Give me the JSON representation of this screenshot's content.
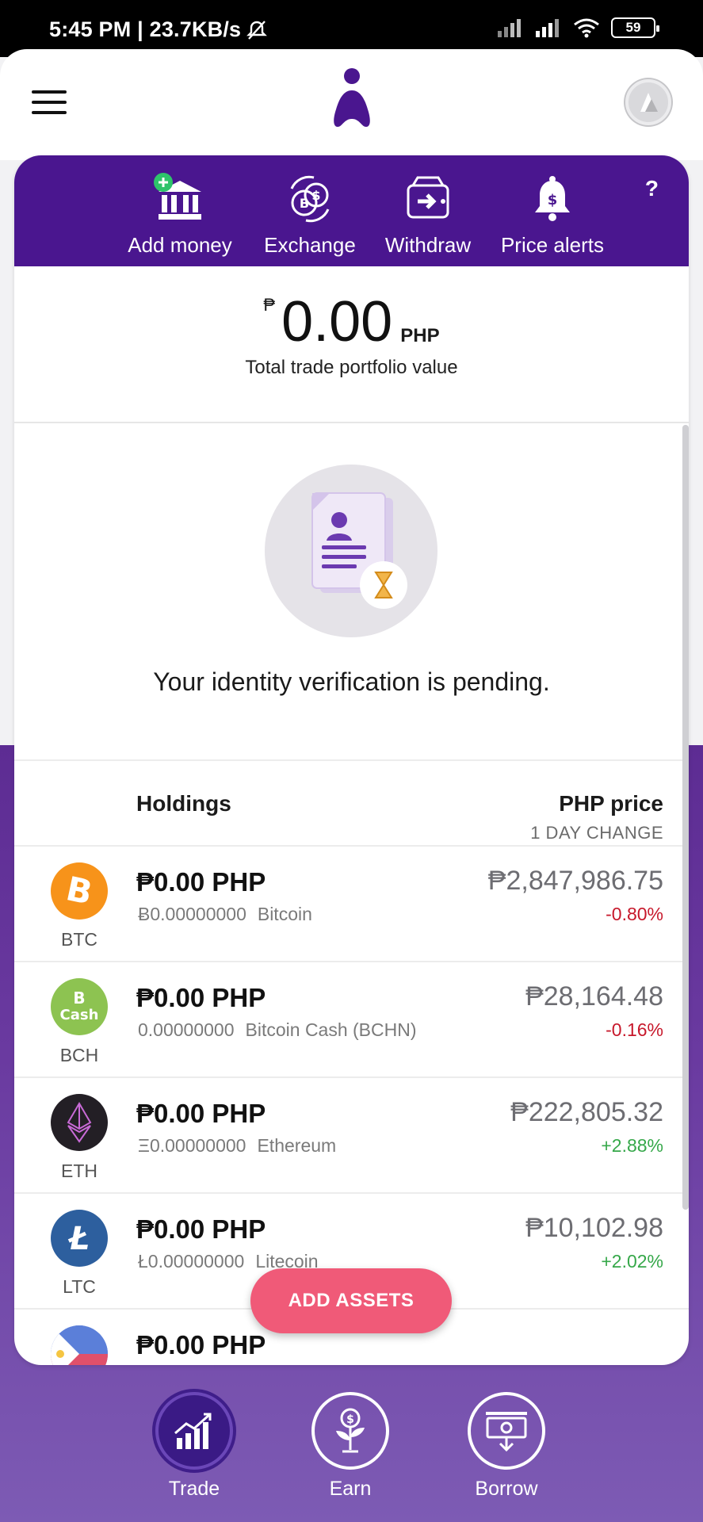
{
  "status_bar": {
    "time": "5:45 PM | 23.7KB/s",
    "battery": "59"
  },
  "header": {
    "menu_icon": "hamburger-menu-icon",
    "logo_icon": "app-logo",
    "profile_icon": "profile-avatar"
  },
  "actions": [
    {
      "label": "Add money",
      "icon": "bank-plus-icon"
    },
    {
      "label": "Exchange",
      "icon": "coins-exchange-icon"
    },
    {
      "label": "Withdraw",
      "icon": "wallet-arrow-icon"
    },
    {
      "label": "Price alerts",
      "icon": "bell-dollar-icon"
    }
  ],
  "help_label": "?",
  "portfolio": {
    "currency_symbol": "₱",
    "value": "0.00",
    "unit": "PHP",
    "label": "Total trade portfolio value"
  },
  "verification": {
    "message": "Your identity verification is pending."
  },
  "holdings_header": {
    "left": "Holdings",
    "right": "PHP price",
    "right_sub": "1 DAY CHANGE"
  },
  "holdings": [
    {
      "ticker": "BTC",
      "amount": "₱0.00 PHP",
      "quantity": "Ƀ0.00000000",
      "name": "Bitcoin",
      "price": "₱2,847,986.75",
      "change": "-0.80%"
    },
    {
      "ticker": "BCH",
      "amount": "₱0.00 PHP",
      "quantity": "0.00000000",
      "name": "Bitcoin Cash (BCHN)",
      "price": "₱28,164.48",
      "change": "-0.16%"
    },
    {
      "ticker": "ETH",
      "amount": "₱0.00 PHP",
      "quantity": "Ξ0.00000000",
      "name": "Ethereum",
      "price": "₱222,805.32",
      "change": "+2.88%"
    },
    {
      "ticker": "LTC",
      "amount": "₱0.00 PHP",
      "quantity": "Ł0.00000000",
      "name": "Litecoin",
      "price": "₱10,102.98",
      "change": "+2.02%"
    },
    {
      "amount": "₱0.00 PHP"
    }
  ],
  "add_assets_label": "ADD ASSETS",
  "bottom_nav": [
    {
      "label": "Trade",
      "icon": "chart-up-icon"
    },
    {
      "label": "Earn",
      "icon": "money-plant-icon"
    },
    {
      "label": "Borrow",
      "icon": "cash-download-icon"
    }
  ],
  "colors": {
    "brand_purple": "#4a168f",
    "accent_pink": "#f05a78",
    "negative": "#c7182b",
    "positive": "#36a84a"
  }
}
